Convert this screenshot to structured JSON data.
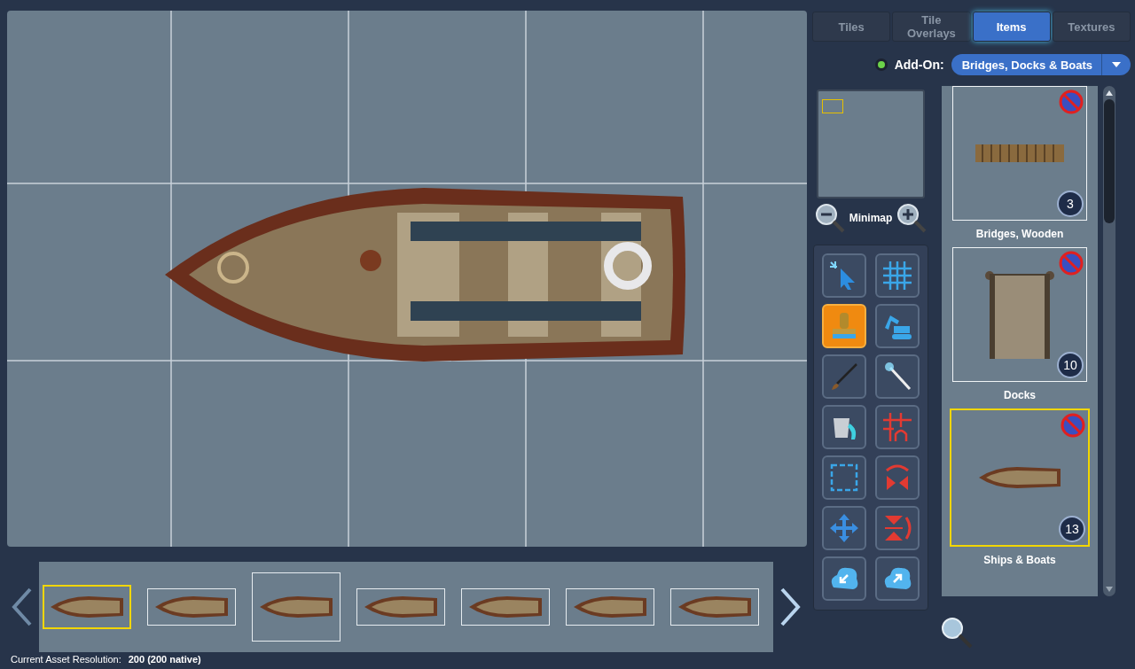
{
  "tabs": [
    {
      "label": "Tiles",
      "selected": false
    },
    {
      "label": "Tile Overlays",
      "selected": false
    },
    {
      "label": "Items",
      "selected": true
    },
    {
      "label": "Textures",
      "selected": false
    }
  ],
  "addon": {
    "label": "Add-On:",
    "enabled": true,
    "value": "Bridges, Docks & Boats"
  },
  "minimap": {
    "label": "Minimap"
  },
  "tools": [
    {
      "kind": "select",
      "selected": false
    },
    {
      "kind": "grid",
      "selected": false
    },
    {
      "kind": "stamp",
      "selected": true
    },
    {
      "kind": "excavator",
      "selected": false
    },
    {
      "kind": "brush",
      "selected": false
    },
    {
      "kind": "wand",
      "selected": false
    },
    {
      "kind": "fill",
      "selected": false
    },
    {
      "kind": "wall",
      "selected": false
    },
    {
      "kind": "marquee",
      "selected": false
    },
    {
      "kind": "flip-h",
      "selected": false
    },
    {
      "kind": "move",
      "selected": false
    },
    {
      "kind": "flip-v",
      "selected": false
    },
    {
      "kind": "import",
      "selected": false
    },
    {
      "kind": "export",
      "selected": false
    }
  ],
  "assets": [
    {
      "name": "Bridges, Wooden",
      "count": "3",
      "kind": "bridge",
      "selected": false
    },
    {
      "name": "Docks",
      "count": "10",
      "kind": "dock",
      "selected": false
    },
    {
      "name": "Ships & Boats",
      "count": "13",
      "kind": "boat",
      "selected": true
    }
  ],
  "filmstrip": [
    {
      "selected": true
    },
    {
      "selected": false
    },
    {
      "selected": false
    },
    {
      "selected": false
    },
    {
      "selected": false
    },
    {
      "selected": false
    },
    {
      "selected": false
    }
  ],
  "status": {
    "label": "Current Asset Resolution:",
    "value": "200 (200 native)"
  }
}
